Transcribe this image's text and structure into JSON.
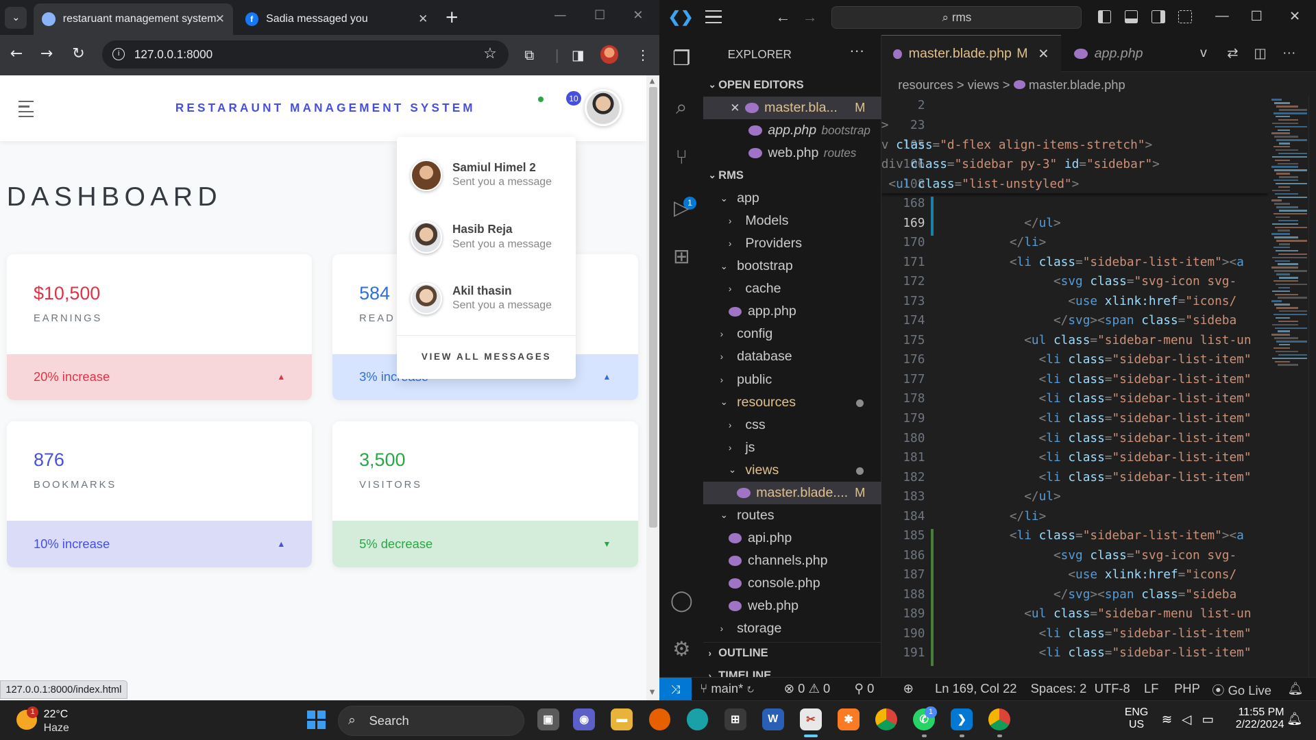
{
  "browser": {
    "tabs": [
      {
        "title": "restaruant management system"
      },
      {
        "title": "Sadia messaged you"
      }
    ],
    "url": "127.0.0.1:8000",
    "status_url": "127.0.0.1:8000/index.html"
  },
  "app": {
    "brand": "RESTARAUNT MANAGEMENT SYSTEM",
    "notification_count": "10",
    "page_title": "DASHBOARD",
    "cards": [
      {
        "value": "$10,500",
        "label": "EARNINGS",
        "footer": "20% increase",
        "trend": "up",
        "accent": "#dc3545",
        "footer_bg": "#f8d7da"
      },
      {
        "value": "584",
        "label": "READ",
        "footer": "3% increase",
        "trend": "up",
        "accent": "#2f6fdf",
        "footer_bg": "#d6e4ff"
      },
      {
        "value": "876",
        "label": "BOOKMARKS",
        "footer": "10% increase",
        "trend": "up",
        "accent": "#4650dd",
        "footer_bg": "#dadcf8"
      },
      {
        "value": "3,500",
        "label": "VISITORS",
        "footer": "5% decrease",
        "trend": "down",
        "accent": "#28a745",
        "footer_bg": "#d4edda"
      }
    ],
    "messages": {
      "items": [
        {
          "name": "Samiul Himel 2",
          "text": "Sent you a message"
        },
        {
          "name": "Hasib Reja",
          "text": "Sent you a message"
        },
        {
          "name": "Akil thasin",
          "text": "Sent you a message"
        }
      ],
      "view_all": "VIEW ALL MESSAGES"
    }
  },
  "vscode": {
    "search": "rms",
    "explorer_title": "EXPLORER",
    "open_editors_label": "OPEN EDITORS",
    "open_editors": [
      {
        "name": "master.bla...",
        "badge": "M",
        "hint": ""
      },
      {
        "name": "app.php",
        "badge": "",
        "hint": "bootstrap"
      },
      {
        "name": "web.php",
        "badge": "",
        "hint": "routes"
      }
    ],
    "workspace_label": "RMS",
    "tree": [
      {
        "name": "app",
        "kind": "open"
      },
      {
        "name": "Models",
        "kind": "closed"
      },
      {
        "name": "Providers",
        "kind": "closed"
      },
      {
        "name": "bootstrap",
        "kind": "open"
      },
      {
        "name": "cache",
        "kind": "closed"
      },
      {
        "name": "app.php",
        "kind": "file"
      },
      {
        "name": "config",
        "kind": "closed"
      },
      {
        "name": "database",
        "kind": "closed"
      },
      {
        "name": "public",
        "kind": "closed"
      },
      {
        "name": "resources",
        "kind": "open"
      },
      {
        "name": "css",
        "kind": "closed"
      },
      {
        "name": "js",
        "kind": "closed"
      },
      {
        "name": "views",
        "kind": "open"
      },
      {
        "name": "master.blade....",
        "kind": "file",
        "badge": "M"
      },
      {
        "name": "routes",
        "kind": "open"
      },
      {
        "name": "api.php",
        "kind": "file"
      },
      {
        "name": "channels.php",
        "kind": "file"
      },
      {
        "name": "console.php",
        "kind": "file"
      },
      {
        "name": "web.php",
        "kind": "file"
      },
      {
        "name": "storage",
        "kind": "closed"
      }
    ],
    "outline_label": "OUTLINE",
    "timeline_label": "TIMELINE",
    "editor_tabs": [
      {
        "name": "master.blade.php",
        "badge": "M"
      },
      {
        "name": "app.php",
        "badge": ""
      }
    ],
    "breadcrumb": [
      "resources",
      "views",
      "master.blade.php"
    ],
    "code": [
      {
        "n": "2",
        "t": ""
      },
      {
        "n": "23",
        "t": ">"
      },
      {
        "n": "105",
        "t": "v class=\"d-flex align-items-stretch\">"
      },
      {
        "n": "106",
        "t": "div class=\"sidebar py-3\" id=\"sidebar\">"
      },
      {
        "n": "108",
        "t": " <ul class=\"list-unstyled\">"
      },
      {
        "n": "168",
        "t": ""
      },
      {
        "n": "169",
        "t": "          </ul>"
      },
      {
        "n": "170",
        "t": "        </li>"
      },
      {
        "n": "171",
        "t": "        <li class=\"sidebar-list-item\"><a"
      },
      {
        "n": "172",
        "t": "              <svg class=\"svg-icon svg-"
      },
      {
        "n": "173",
        "t": "                <use xlink:href=\"icons/"
      },
      {
        "n": "174",
        "t": "              </svg><span class=\"sideba"
      },
      {
        "n": "175",
        "t": "          <ul class=\"sidebar-menu list-un"
      },
      {
        "n": "176",
        "t": "            <li class=\"sidebar-list-item\""
      },
      {
        "n": "177",
        "t": "            <li class=\"sidebar-list-item\""
      },
      {
        "n": "178",
        "t": "            <li class=\"sidebar-list-item\""
      },
      {
        "n": "179",
        "t": "            <li class=\"sidebar-list-item\""
      },
      {
        "n": "180",
        "t": "            <li class=\"sidebar-list-item\""
      },
      {
        "n": "181",
        "t": "            <li class=\"sidebar-list-item\""
      },
      {
        "n": "182",
        "t": "            <li class=\"sidebar-list-item\""
      },
      {
        "n": "183",
        "t": "          </ul>"
      },
      {
        "n": "184",
        "t": "        </li>"
      },
      {
        "n": "185",
        "t": "        <li class=\"sidebar-list-item\"><a"
      },
      {
        "n": "186",
        "t": "              <svg class=\"svg-icon svg-"
      },
      {
        "n": "187",
        "t": "                <use xlink:href=\"icons/"
      },
      {
        "n": "188",
        "t": "              </svg><span class=\"sideba"
      },
      {
        "n": "189",
        "t": "          <ul class=\"sidebar-menu list-un"
      },
      {
        "n": "190",
        "t": "            <li class=\"sidebar-list-item\""
      },
      {
        "n": "191",
        "t": "            <li class=\"sidebar-list-item\""
      }
    ],
    "status": {
      "branch": "main*",
      "problems": "⊗ 0 ⚠ 0",
      "ports": "0",
      "position": "Ln 169, Col 22",
      "spaces": "Spaces: 2",
      "encoding": "UTF-8",
      "eol": "LF",
      "language": "PHP",
      "golive": "Go Live"
    }
  },
  "taskbar": {
    "weather_badge": "1",
    "temp": "22°C",
    "condition": "Haze",
    "search": "Search",
    "lang1": "ENG",
    "lang2": "US",
    "time": "11:55 PM",
    "date": "2/22/2024",
    "whatsapp_badge": "1"
  },
  "colors": {
    "accent": "#4650dd",
    "vscode_blue": "#0078d4",
    "modified": "#e2c08d"
  }
}
